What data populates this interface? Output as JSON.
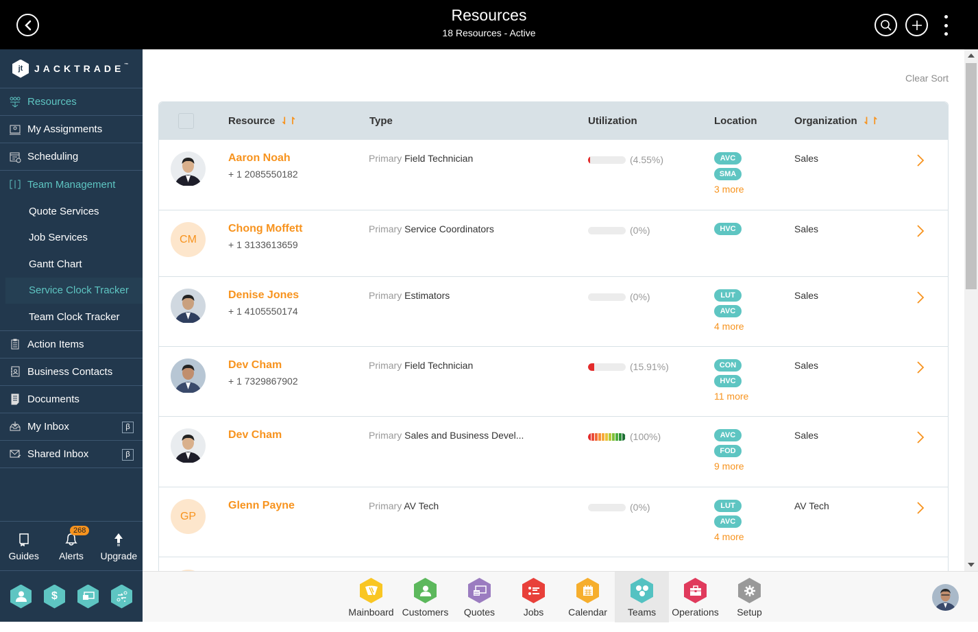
{
  "header": {
    "title": "Resources",
    "subtitle": "18 Resources - Active"
  },
  "sidebar": {
    "brand": "JACKTRADE",
    "brand_mark": "™",
    "items": [
      {
        "label": "Resources",
        "icon": "resources-icon",
        "active": true
      },
      {
        "label": "My Assignments",
        "icon": "assignments-icon"
      },
      {
        "label": "Scheduling",
        "icon": "scheduling-icon"
      },
      {
        "label": "Team Management",
        "icon": "team-management-icon",
        "active": true
      },
      {
        "label": "Action Items",
        "icon": "clipboard-icon"
      },
      {
        "label": "Business Contacts",
        "icon": "contacts-icon"
      },
      {
        "label": "Documents",
        "icon": "document-icon"
      },
      {
        "label": "My Inbox",
        "icon": "inbox-icon",
        "badge": "β"
      },
      {
        "label": "Shared Inbox",
        "icon": "mail-icon",
        "badge": "β"
      }
    ],
    "team_sub_items": [
      {
        "label": "Quote Services"
      },
      {
        "label": "Job Services"
      },
      {
        "label": "Gantt Chart"
      },
      {
        "label": "Service Clock Tracker",
        "active": true
      },
      {
        "label": "Team Clock Tracker"
      }
    ],
    "tools": [
      {
        "label": "Guides",
        "icon": "book-icon"
      },
      {
        "label": "Alerts",
        "icon": "bell-icon",
        "badge": "268"
      },
      {
        "label": "Upgrade",
        "icon": "arrow-up-icon"
      }
    ],
    "apps": [
      {
        "icon": "person-icon"
      },
      {
        "icon": "dollar-icon"
      },
      {
        "icon": "money-icon"
      },
      {
        "icon": "workflow-icon"
      }
    ]
  },
  "main": {
    "clear_sort": "Clear Sort",
    "columns": {
      "resource": "Resource",
      "type": "Type",
      "utilization": "Utilization",
      "location": "Location",
      "organization": "Organization"
    },
    "rows": [
      {
        "name": "Aaron Noah",
        "phone": "+ 1 2085550182",
        "avatar": "photo",
        "type_prefix": "Primary",
        "type": "Field Technician",
        "utilization": 4.55,
        "utilization_label": "(4.55%)",
        "locations": [
          "AVC",
          "SMA"
        ],
        "more": "3 more",
        "organization": "Sales"
      },
      {
        "name": "Chong Moffett",
        "phone": "+ 1 3133613659",
        "initials": "CM",
        "type_prefix": "Primary",
        "type": "Service Coordinators",
        "utilization": 0,
        "utilization_label": "(0%)",
        "locations": [
          "HVC"
        ],
        "more": "",
        "organization": "Sales"
      },
      {
        "name": "Denise Jones",
        "phone": "+ 1 4105550174",
        "avatar": "photo",
        "type_prefix": "Primary",
        "type": "Estimators",
        "utilization": 0,
        "utilization_label": "(0%)",
        "locations": [
          "LUT",
          "AVC"
        ],
        "more": "4 more",
        "organization": "Sales"
      },
      {
        "name": "Dev Cham",
        "phone": "+ 1 7329867902",
        "avatar": "photo",
        "type_prefix": "Primary",
        "type": "Field Technician",
        "utilization": 15.91,
        "utilization_label": "(15.91%)",
        "locations": [
          "CON",
          "HVC"
        ],
        "more": "11 more",
        "organization": "Sales"
      },
      {
        "name": "Dev Cham",
        "phone": "",
        "avatar": "photo",
        "type_prefix": "Primary",
        "type": "Sales and Business Devel...",
        "utilization": 100,
        "utilization_label": "(100%)",
        "locations": [
          "AVC",
          "FOD"
        ],
        "more": "9 more",
        "organization": "Sales"
      },
      {
        "name": "Glenn Payne",
        "phone": "",
        "initials": "GP",
        "type_prefix": "Primary",
        "type": "AV Tech",
        "utilization": 0,
        "utilization_label": "(0%)",
        "locations": [
          "LUT",
          "AVC"
        ],
        "more": "4 more",
        "organization": "AV Tech"
      }
    ]
  },
  "dock": {
    "items": [
      {
        "label": "Mainboard",
        "color": "#f9c623",
        "icon": "mainboard-icon"
      },
      {
        "label": "Customers",
        "color": "#5cb85c",
        "icon": "customers-icon"
      },
      {
        "label": "Quotes",
        "color": "#9b7cc0",
        "icon": "quotes-icon"
      },
      {
        "label": "Jobs",
        "color": "#e8403a",
        "icon": "jobs-icon"
      },
      {
        "label": "Calendar",
        "color": "#f6ae2d",
        "icon": "calendar-icon"
      },
      {
        "label": "Teams",
        "color": "#54c2c2",
        "icon": "teams-icon",
        "active": true
      },
      {
        "label": "Operations",
        "color": "#e03a5c",
        "icon": "operations-icon"
      },
      {
        "label": "Setup",
        "color": "#999999",
        "icon": "setup-icon"
      }
    ]
  },
  "colors": {
    "accent": "#f7931e",
    "teal": "#5ec5c2",
    "sidebar": "#22384d",
    "header_bg": "#d8e1e6"
  }
}
